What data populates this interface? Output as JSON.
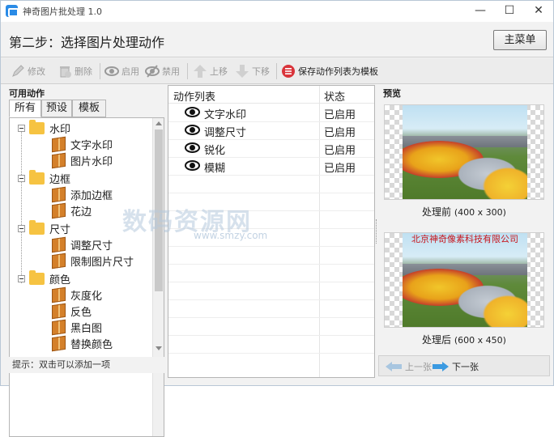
{
  "window": {
    "title": "神奇图片批处理 1.0",
    "controls": [
      "—",
      "☐",
      "✕"
    ]
  },
  "step": {
    "title": "第二步：选择图片处理动作",
    "main_menu": "主菜单"
  },
  "toolbar": {
    "edit": "修改",
    "delete": "删除",
    "enable": "启用",
    "disable": "禁用",
    "move_up": "上移",
    "move_down": "下移",
    "save_template": "保存动作列表为模板"
  },
  "left": {
    "label": "可用动作",
    "tabs": [
      "所有",
      "预设",
      "模板"
    ],
    "tree": [
      {
        "group": "水印",
        "items": [
          "文字水印",
          "图片水印"
        ]
      },
      {
        "group": "边框",
        "items": [
          "添加边框",
          "花边"
        ]
      },
      {
        "group": "尺寸",
        "items": [
          "调整尺寸",
          "限制图片尺寸"
        ]
      },
      {
        "group": "颜色",
        "items": [
          "灰度化",
          "反色",
          "黑白图",
          "替换颜色"
        ]
      }
    ],
    "hint": "提示：双击可以添加一项"
  },
  "actions": {
    "col_name": "动作列表",
    "col_state": "状态",
    "rows": [
      {
        "name": "文字水印",
        "state": "已启用"
      },
      {
        "name": "调整尺寸",
        "state": "已启用"
      },
      {
        "name": "锐化",
        "state": "已启用"
      },
      {
        "name": "模糊",
        "state": "已启用"
      }
    ]
  },
  "preview": {
    "label": "预览",
    "before_caption": "处理前",
    "before_size": "(400 x 300)",
    "watermark_text": "北京神奇像素科技有限公司",
    "after_caption": "处理后",
    "after_size": "(600 x 450)",
    "prev": "上一张",
    "next": "下一张"
  },
  "site_watermark": {
    "logo": "数码资源网",
    "url": "www.smzy.com"
  }
}
